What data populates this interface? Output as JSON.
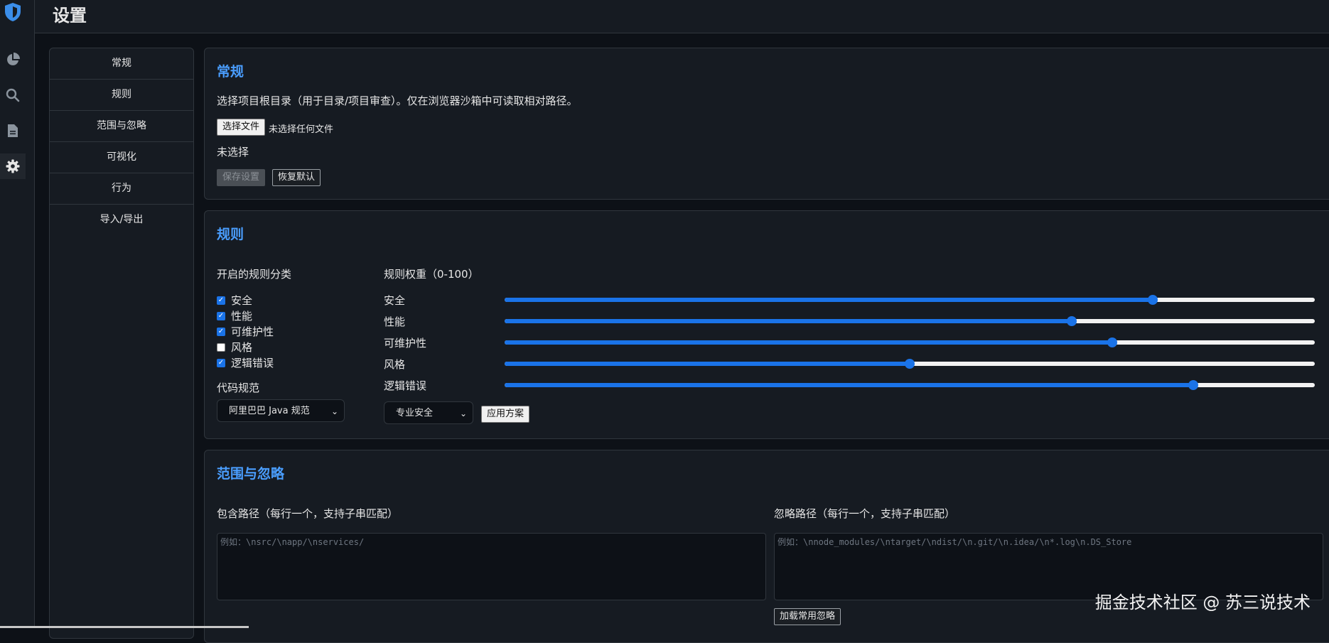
{
  "header": {
    "title": "设置"
  },
  "rail": {
    "icons": [
      "shield-logo-icon",
      "pie-chart-icon",
      "search-icon",
      "document-icon",
      "gear-icon"
    ]
  },
  "sidemenu": {
    "items": [
      "常规",
      "规则",
      "范围与忽略",
      "可视化",
      "行为",
      "导入/导出"
    ]
  },
  "general": {
    "title": "常规",
    "description": "选择项目根目录（用于目录/项目审查）。仅在浏览器沙箱中可读取相对路径。",
    "choose_file_label": "选择文件",
    "no_file_text": "未选择任何文件",
    "selection_status": "未选择",
    "save_label": "保存设置",
    "reset_label": "恢复默认"
  },
  "rules": {
    "title": "规则",
    "categories_heading": "开启的规则分类",
    "categories": [
      {
        "label": "安全",
        "checked": true
      },
      {
        "label": "性能",
        "checked": true
      },
      {
        "label": "可维护性",
        "checked": true
      },
      {
        "label": "风格",
        "checked": false
      },
      {
        "label": "逻辑错误",
        "checked": true
      }
    ],
    "code_standard_label": "代码规范",
    "code_standard_value": "阿里巴巴 Java 规范",
    "weights_heading": "规则权重（0-100）",
    "weights": [
      {
        "label": "安全",
        "value": 80
      },
      {
        "label": "性能",
        "value": 70
      },
      {
        "label": "可维护性",
        "value": 75
      },
      {
        "label": "风格",
        "value": 50
      },
      {
        "label": "逻辑错误",
        "value": 85
      }
    ],
    "preset_value": "专业安全",
    "apply_label": "应用方案"
  },
  "scope": {
    "title": "范围与忽略",
    "include_label": "包含路径（每行一个，支持子串匹配）",
    "include_placeholder": "例如：\\nsrc/\\napp/\\nservices/",
    "ignore_label": "忽略路径（每行一个，支持子串匹配）",
    "ignore_placeholder": "例如：\\nnode_modules/\\ntarget/\\ndist/\\n.git/\\n.idea/\\n*.log\\n.DS_Store",
    "load_common_label": "加载常用忽略"
  },
  "watermark": "掘金技术社区 @ 苏三说技术"
}
